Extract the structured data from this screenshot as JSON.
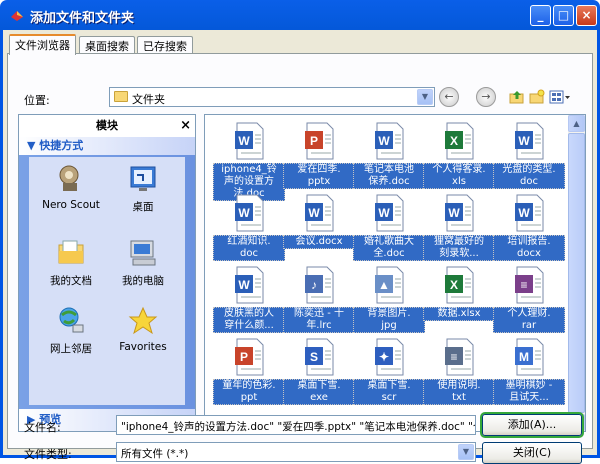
{
  "window": {
    "title": "添加文件和文件夹"
  },
  "titlebar_buttons": {
    "minimize": "_",
    "maximize": "□",
    "close": "×"
  },
  "tabs": [
    {
      "label": "文件浏览器",
      "active": true
    },
    {
      "label": "桌面搜索",
      "active": false
    },
    {
      "label": "已存搜索",
      "active": false
    }
  ],
  "location": {
    "label": "位置:",
    "value": "文件夹"
  },
  "nav": {
    "back": "←",
    "forward": "→"
  },
  "sidebar": {
    "title": "模块",
    "close": "×",
    "section": "快捷方式",
    "items": [
      {
        "label": "Nero Scout",
        "icon": "nero-scout-icon"
      },
      {
        "label": "桌面",
        "icon": "desktop-icon"
      },
      {
        "label": "我的文档",
        "icon": "my-documents-icon"
      },
      {
        "label": "我的电脑",
        "icon": "my-computer-icon"
      },
      {
        "label": "网上邻居",
        "icon": "network-icon"
      },
      {
        "label": "Favorites",
        "icon": "favorites-star-icon"
      }
    ],
    "preview": "预览"
  },
  "files": [
    {
      "l1": "iphone4_铃",
      "l2": "声的设置方",
      "l3": "法.doc",
      "type": "doc"
    },
    {
      "l1": "爱在四季.",
      "l2": "pptx",
      "l3": "",
      "type": "ppt"
    },
    {
      "l1": "笔记本电池",
      "l2": "保养.doc",
      "l3": "",
      "type": "doc"
    },
    {
      "l1": "个人得客录.",
      "l2": "xls",
      "l3": "",
      "type": "xls"
    },
    {
      "l1": "光盘的类型.",
      "l2": "doc",
      "l3": "",
      "type": "doc"
    },
    {
      "l1": "红酒知识.",
      "l2": "doc",
      "l3": "",
      "type": "doc"
    },
    {
      "l1": "会议.docx",
      "l2": "",
      "l3": "",
      "type": "doc"
    },
    {
      "l1": "婚礼歌曲大",
      "l2": "全.doc",
      "l3": "",
      "type": "doc"
    },
    {
      "l1": "狸窝最好的",
      "l2": "刻录软...",
      "l3": "",
      "type": "doc"
    },
    {
      "l1": "培训报告.",
      "l2": "docx",
      "l3": "",
      "type": "doc"
    },
    {
      "l1": "皮肤黑的人",
      "l2": "穿什么颜...",
      "l3": "",
      "type": "doc"
    },
    {
      "l1": "陈奕迅 - 十",
      "l2": "年.lrc",
      "l3": "",
      "type": "lrc"
    },
    {
      "l1": "背景图片.",
      "l2": "jpg",
      "l3": "",
      "type": "jpg"
    },
    {
      "l1": "数据.xlsx",
      "l2": "",
      "l3": "",
      "type": "xls"
    },
    {
      "l1": "个人理财.",
      "l2": "rar",
      "l3": "",
      "type": "rar"
    },
    {
      "l1": "童年的色彩.",
      "l2": "ppt",
      "l3": "",
      "type": "ppt"
    },
    {
      "l1": "桌面下雪.",
      "l2": "exe",
      "l3": "",
      "type": "exe"
    },
    {
      "l1": "桌面下雪.",
      "l2": "scr",
      "l3": "",
      "type": "scr"
    },
    {
      "l1": "使用说明.",
      "l2": "txt",
      "l3": "",
      "type": "txt"
    },
    {
      "l1": "墨明棋妙 -",
      "l2": "且试天...",
      "l3": "",
      "type": "mp3"
    }
  ],
  "filename": {
    "label": "文件名:",
    "value": "\"iphone4_铃声的设置方法.doc\" \"爱在四季.pptx\" \"笔记本电池保养.doc\" \"个"
  },
  "filetype": {
    "label": "文件类型:",
    "value": "所有文件 (*.*)"
  },
  "buttons": {
    "add": "添加(A)...",
    "close": "关闭(C)"
  },
  "colors": {
    "titlebar": "#0058e6",
    "selection": "#316ac5",
    "panel_bg": "#ece9d8",
    "focus_ring": "#35a83a"
  }
}
